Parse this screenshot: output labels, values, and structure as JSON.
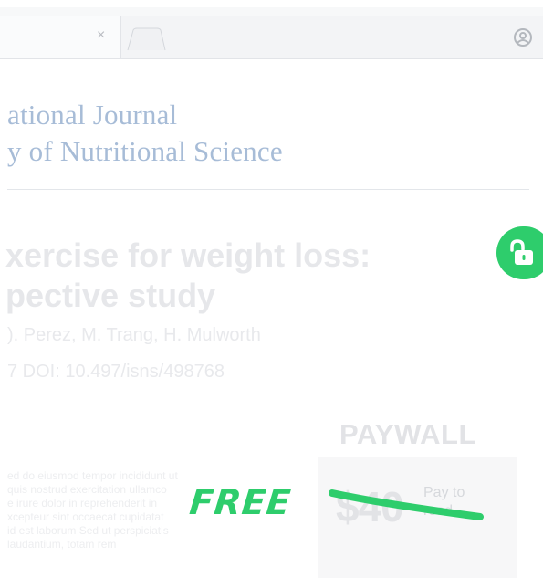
{
  "browser": {
    "tab_close": "×"
  },
  "journal": {
    "line1": "ational Journal",
    "line2": "y of Nutritional Science"
  },
  "article": {
    "title_line1": "xercise for weight loss:",
    "title_line2": "pective study",
    "authors": "). Perez, M. Trang, H. Mulworth",
    "doi": "7   DOI: 10.497/isns/498768"
  },
  "body_lines": [
    "ed do eiusmod tempor incididunt ut",
    "quis nostrud exercitation ullamco",
    "e irure dolor in reprehenderit in",
    "xcepteur sint occaecat cupidatat",
    "id est laborum Sed ut perspiciatis",
    "laudantium, totam rem"
  ],
  "paywall": {
    "label": "PAYWALL",
    "price": "$40",
    "pay_line1": "Pay to",
    "pay_line2": "read"
  },
  "overlay": {
    "free_label": "FREE"
  },
  "colors": {
    "accent_green": "#2ecd6c",
    "journal_blue": "#a7bcd7"
  }
}
